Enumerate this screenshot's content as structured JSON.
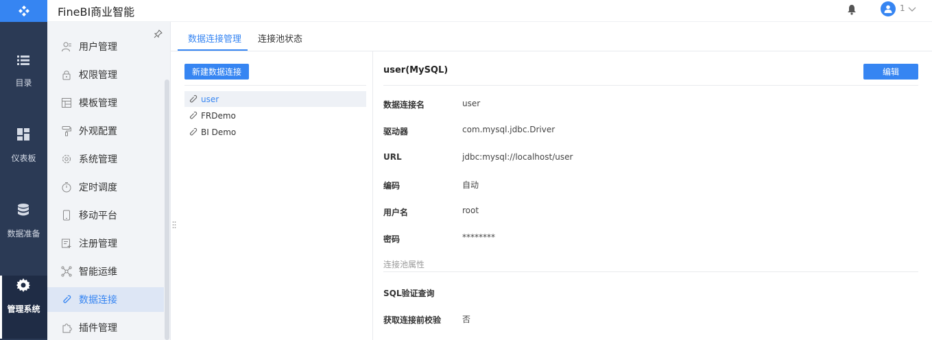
{
  "header": {
    "app_title": "FineBI商业智能",
    "user_name": "1"
  },
  "rail": {
    "items": [
      {
        "label": "目录",
        "icon": "list-icon"
      },
      {
        "label": "仪表板",
        "icon": "dashboard-icon"
      },
      {
        "label": "数据准备",
        "icon": "database-icon"
      },
      {
        "label": "管理系统",
        "icon": "gear-icon"
      }
    ],
    "active": "管理系统"
  },
  "sidebar": {
    "items": [
      {
        "label": "用户管理",
        "icon": "user-icon"
      },
      {
        "label": "权限管理",
        "icon": "lock-icon"
      },
      {
        "label": "模板管理",
        "icon": "template-icon"
      },
      {
        "label": "外观配置",
        "icon": "paint-roller-icon"
      },
      {
        "label": "系统管理",
        "icon": "settings-icon"
      },
      {
        "label": "定时调度",
        "icon": "timer-icon"
      },
      {
        "label": "移动平台",
        "icon": "mobile-icon"
      },
      {
        "label": "注册管理",
        "icon": "register-icon"
      },
      {
        "label": "智能运维",
        "icon": "network-icon"
      },
      {
        "label": "数据连接",
        "icon": "link-icon"
      },
      {
        "label": "插件管理",
        "icon": "plugin-icon"
      }
    ],
    "active": "数据连接"
  },
  "tabs": [
    {
      "label": "数据连接管理",
      "active": true
    },
    {
      "label": "连接池状态",
      "active": false
    }
  ],
  "list": {
    "new_button": "新建数据连接",
    "connections": [
      {
        "name": "user",
        "active": true
      },
      {
        "name": "FRDemo",
        "active": false
      },
      {
        "name": "BI Demo",
        "active": false
      }
    ]
  },
  "detail": {
    "title": "user(MySQL)",
    "edit_button": "编辑",
    "fields": [
      {
        "label": "数据连接名",
        "value": "user"
      },
      {
        "label": "驱动器",
        "value": "com.mysql.jdbc.Driver"
      },
      {
        "label": "URL",
        "value": "jdbc:mysql://localhost/user"
      },
      {
        "label": "编码",
        "value": "自动"
      },
      {
        "label": "用户名",
        "value": "root"
      },
      {
        "label": "密码",
        "value": "********"
      }
    ],
    "pool_section": "连接池属性",
    "pool_fields": [
      {
        "label": "SQL验证查询",
        "value": ""
      },
      {
        "label": "获取连接前校验",
        "value": "否"
      }
    ]
  },
  "colors": {
    "accent": "#3685f2",
    "rail_bg": "#2b3a55",
    "sidebar_bg": "#f2f4f7"
  }
}
